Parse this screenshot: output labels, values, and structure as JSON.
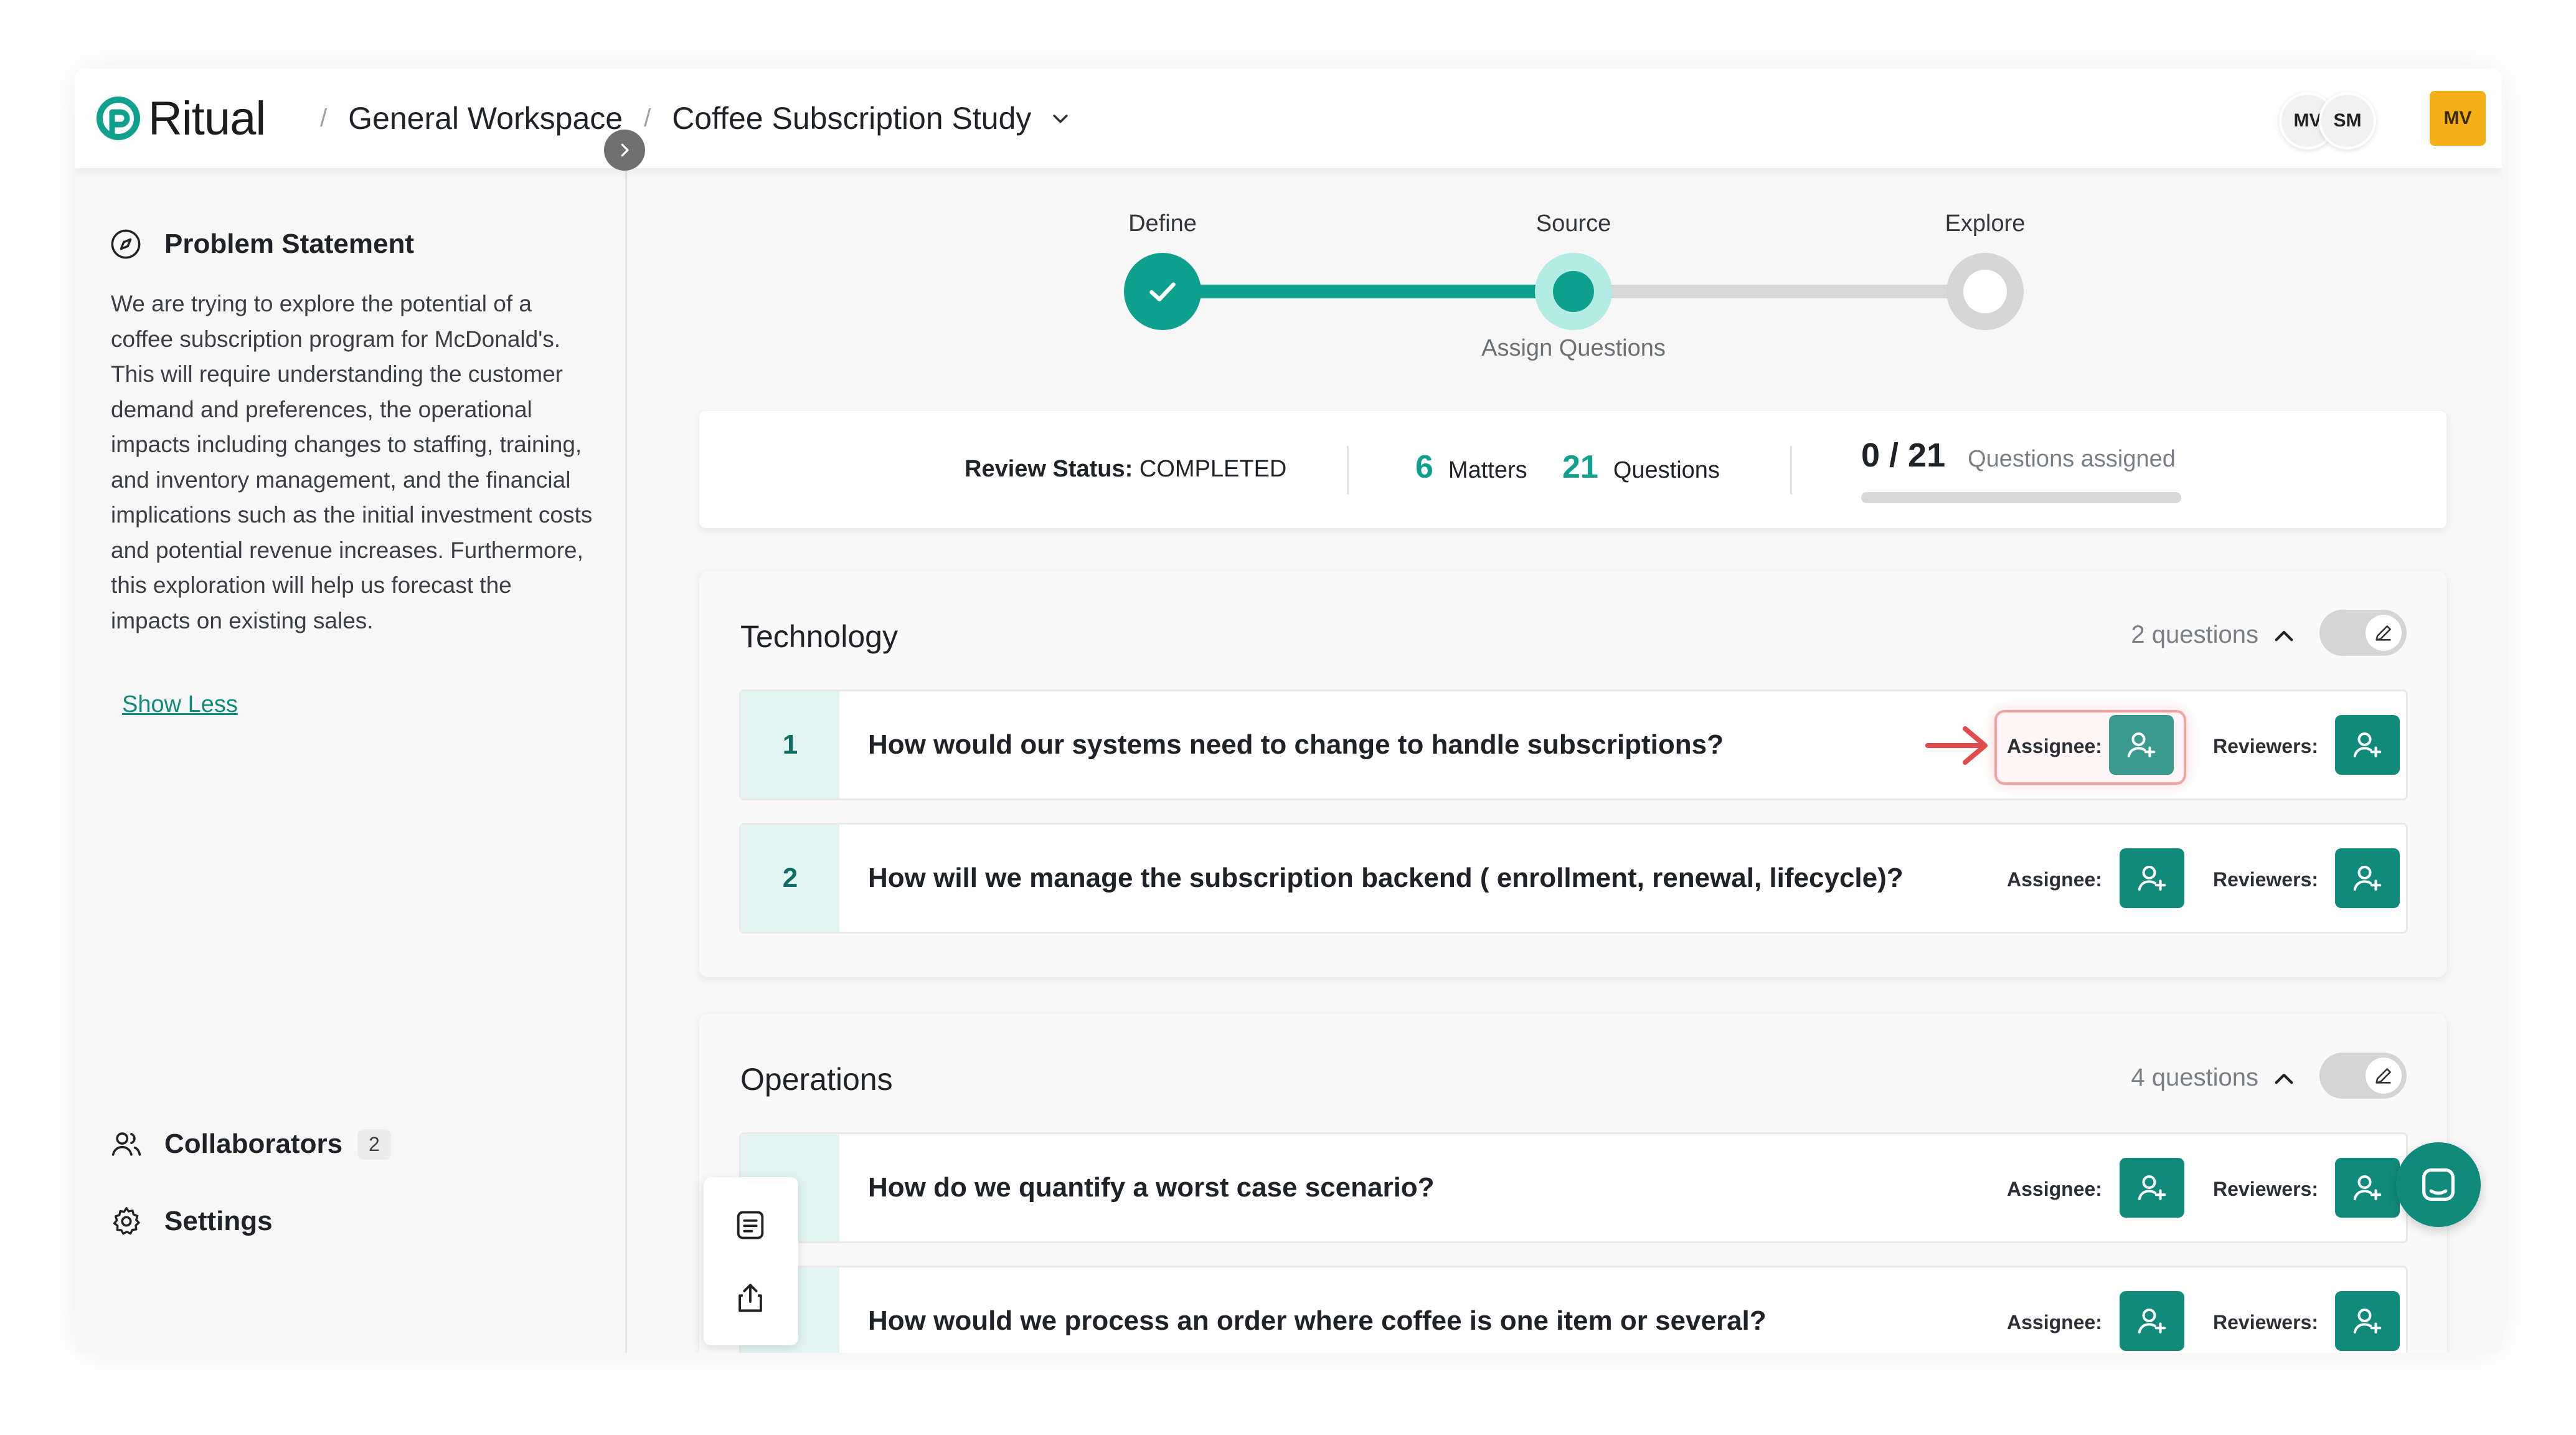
{
  "brand": {
    "name": "Ritual",
    "color": "#10a08e"
  },
  "breadcrumbs": {
    "workspace": "General Workspace",
    "project": "Coffee Subscription Study"
  },
  "collaborator_avatars": [
    "MV",
    "SM"
  ],
  "current_user_initials": "MV",
  "sidebar": {
    "title": "Problem Statement",
    "body": "We are trying to explore the potential of a coffee subscription program for McDonald's. This will require understanding the customer demand and preferences, the operational impacts including changes to staffing, training, and inventory management, and the financial implications such as the initial investment costs and potential revenue increases. Furthermore, this exploration will help us forecast the impacts on existing sales.",
    "show_less": "Show Less",
    "collaborators_label": "Collaborators",
    "collaborators_count": "2",
    "settings_label": "Settings"
  },
  "stepper": {
    "steps": [
      {
        "label": "Define",
        "state": "done"
      },
      {
        "label": "Source",
        "state": "current"
      },
      {
        "label": "Explore",
        "state": "upcoming"
      }
    ],
    "current_sub_label": "Assign Questions"
  },
  "stats": {
    "review_status_label": "Review Status:",
    "review_status_value": "COMPLETED",
    "matters_count": "6",
    "matters_label": "Matters",
    "questions_count": "21",
    "questions_label": "Questions",
    "assigned_fraction": "0 / 21",
    "assigned_label": "Questions assigned",
    "assigned_progress": 0
  },
  "labels": {
    "assignee": "Assignee:",
    "reviewers": "Reviewers:"
  },
  "sections": [
    {
      "title": "Technology",
      "count_label": "2 questions",
      "questions": [
        {
          "number": "1",
          "text": "How would our systems need to change to handle subscriptions?"
        },
        {
          "number": "2",
          "text": "How will we manage the subscription backend ( enrollment, renewal, lifecycle)?"
        }
      ]
    },
    {
      "title": "Operations",
      "count_label": "4 questions",
      "questions": [
        {
          "number": "",
          "text": "How do we quantify a worst case scenario?"
        },
        {
          "number": "",
          "text": "How would we process an order where coffee is one item or several?"
        }
      ]
    }
  ],
  "icons": {
    "problem": "compass-icon",
    "collaborators": "users-icon",
    "settings": "gear-icon",
    "add_user": "user-plus-icon",
    "edit": "pencil-icon",
    "notes": "document-icon",
    "share": "share-icon",
    "chat": "chat-icon",
    "annotation": "red-arrow-icon"
  }
}
